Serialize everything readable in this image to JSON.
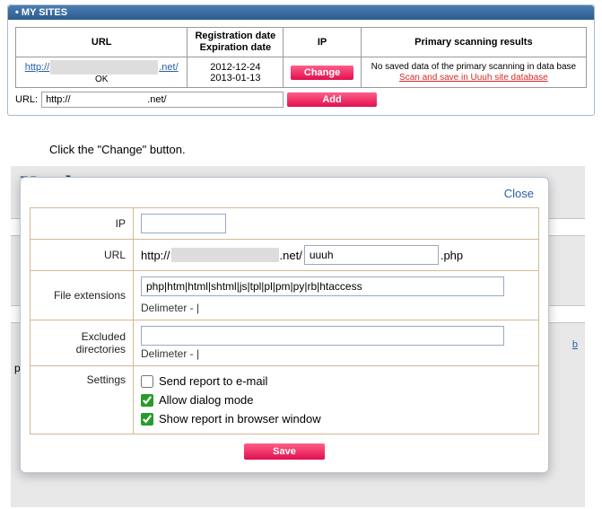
{
  "panel": {
    "title": "• MY SITES",
    "headers": {
      "url": "URL",
      "reg_line1": "Registration date",
      "reg_line2": "Expiration date",
      "ip": "IP",
      "primary": "Primary scanning results"
    },
    "row": {
      "url_prefix": "http://",
      "url_suffix": ".net/",
      "status": "OK",
      "reg_date": "2012-12-24",
      "exp_date": "2013-01-13",
      "change_label": "Change",
      "scan_msg": "No saved data of the primary scanning in data base",
      "scan_link": "Scan and save in Uuuh site database"
    },
    "add": {
      "label": "URL:",
      "value": "http://                            .net/",
      "button": "Add"
    }
  },
  "instruction": "Click the \"Change\" button.",
  "bg": {
    "title": "Uuuh",
    "link_b": "b"
  },
  "modal": {
    "close": "Close",
    "labels": {
      "ip": "IP",
      "url": "URL",
      "ext": "File extensions",
      "excl": "Excluded directories",
      "settings": "Settings"
    },
    "ip_value": "",
    "url": {
      "scheme": "http://",
      "tld": ".net/",
      "path_value": "uuuh",
      "ext": ".php"
    },
    "ext_value": "php|htm|html|shtml|js|tpl|pl|pm|py|rb|htaccess",
    "delimiter_note": "Delimeter - |",
    "excl_value": "",
    "settings": {
      "send_report": {
        "label": "Send report to e-mail",
        "checked": false
      },
      "dialog_mode": {
        "label": "Allow dialog mode",
        "checked": true
      },
      "browser_report": {
        "label": "Show report in browser window",
        "checked": true
      }
    },
    "save": "Save"
  }
}
